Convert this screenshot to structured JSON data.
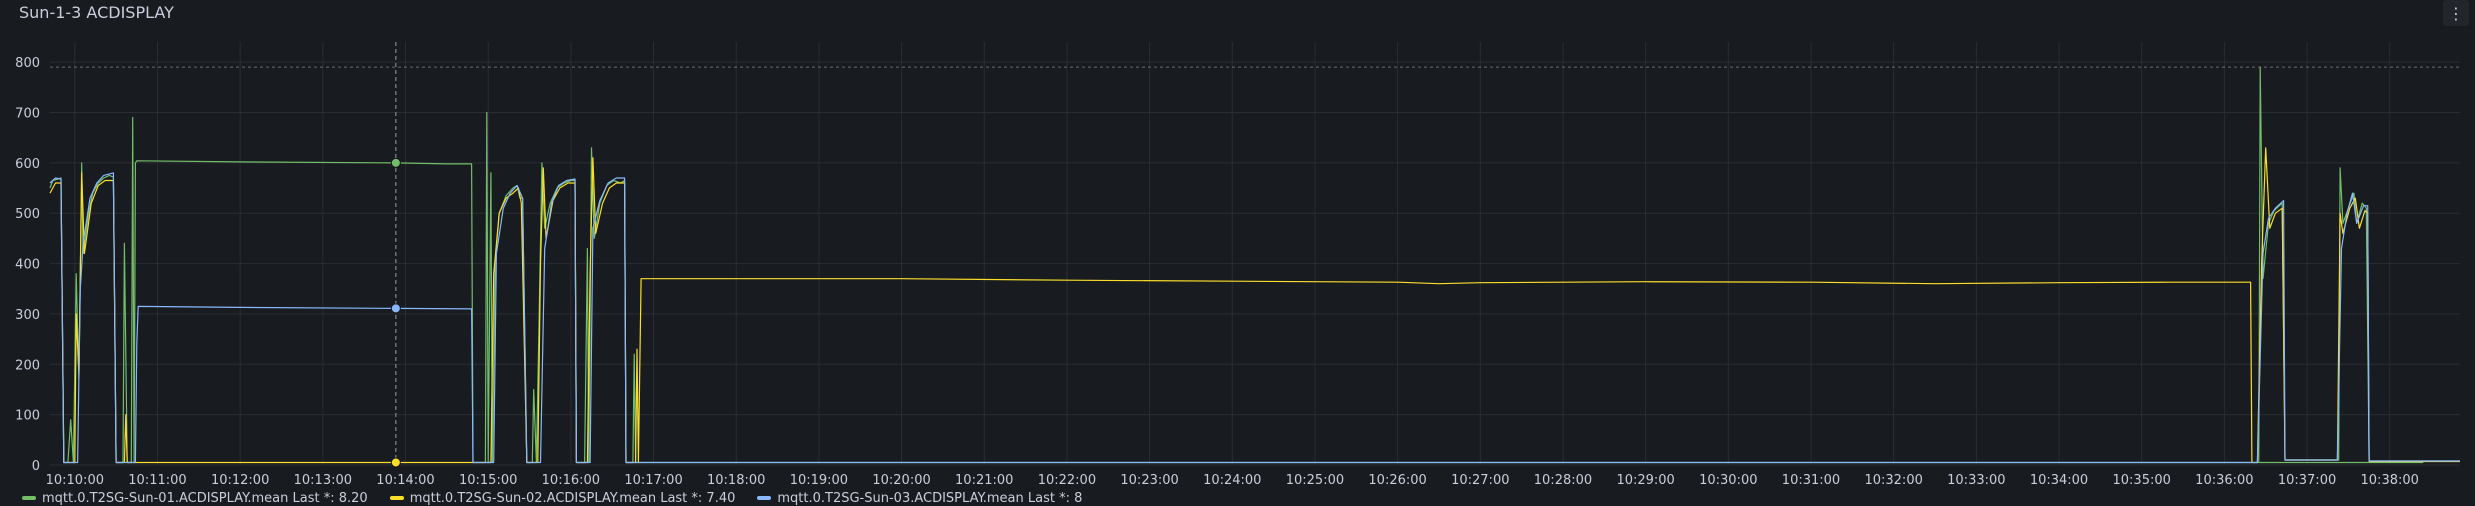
{
  "panel": {
    "title": "Sun-1-3 ACDISPLAY",
    "menu_icon": "vertical-dots-icon"
  },
  "chart_data": {
    "type": "line",
    "title": "Sun-1-3 ACDISPLAY",
    "xlabel": "",
    "ylabel": "",
    "x_unit": "time",
    "x_range": [
      "10:09:42",
      "10:38:51"
    ],
    "ylim": [
      0,
      840
    ],
    "threshold": 790,
    "y_ticks": [
      0,
      100,
      200,
      300,
      400,
      500,
      600,
      700,
      800
    ],
    "x_ticks": [
      "10:10:00",
      "10:11:00",
      "10:12:00",
      "10:13:00",
      "10:14:00",
      "10:15:00",
      "10:16:00",
      "10:17:00",
      "10:18:00",
      "10:19:00",
      "10:20:00",
      "10:21:00",
      "10:22:00",
      "10:23:00",
      "10:24:00",
      "10:25:00",
      "10:26:00",
      "10:27:00",
      "10:28:00",
      "10:29:00",
      "10:30:00",
      "10:31:00",
      "10:32:00",
      "10:33:00",
      "10:34:00",
      "10:35:00",
      "10:36:00",
      "10:37:00",
      "10:38:00"
    ],
    "crosshair_time": "10:13:53",
    "grid": true,
    "legend_position": "bottom",
    "series": [
      {
        "name": "mqtt.0.T2SG-Sun-01.ACDISPLAY.mean",
        "legend": "mqtt.0.T2SG-Sun-01.ACDISPLAY.mean  Last *: 8.20",
        "color": "#73bf69",
        "points": [
          [
            "10:09:42",
            550
          ],
          [
            "10:09:44",
            565
          ],
          [
            "10:09:48",
            568
          ],
          [
            "10:09:50",
            570
          ],
          [
            "10:09:52",
            5
          ],
          [
            "10:09:55",
            5
          ],
          [
            "10:09:57",
            90
          ],
          [
            "10:09:59",
            5
          ],
          [
            "10:10:01",
            380
          ],
          [
            "10:10:03",
            170
          ],
          [
            "10:10:05",
            600
          ],
          [
            "10:10:06",
            420
          ],
          [
            "10:10:10",
            500
          ],
          [
            "10:10:13",
            540
          ],
          [
            "10:10:17",
            560
          ],
          [
            "10:10:21",
            570
          ],
          [
            "10:10:25",
            575
          ],
          [
            "10:10:28",
            572
          ],
          [
            "10:10:30",
            5
          ],
          [
            "10:10:35",
            5
          ],
          [
            "10:10:36",
            440
          ],
          [
            "10:10:38",
            5
          ],
          [
            "10:10:41",
            5
          ],
          [
            "10:10:42",
            690
          ],
          [
            "10:10:43",
            5
          ],
          [
            "10:10:44",
            600
          ],
          [
            "10:10:45",
            604
          ],
          [
            "10:12:00",
            602
          ],
          [
            "10:13:53",
            600
          ],
          [
            "10:14:30",
            598
          ],
          [
            "10:14:48",
            598
          ],
          [
            "10:14:49",
            5
          ],
          [
            "10:14:58",
            5
          ],
          [
            "10:14:59",
            700
          ],
          [
            "10:15:00",
            5
          ],
          [
            "10:15:02",
            580
          ],
          [
            "10:15:03",
            5
          ],
          [
            "10:15:05",
            400
          ],
          [
            "10:15:08",
            500
          ],
          [
            "10:15:13",
            535
          ],
          [
            "10:15:18",
            550
          ],
          [
            "10:15:21",
            555
          ],
          [
            "10:15:23",
            530
          ],
          [
            "10:15:25",
            530
          ],
          [
            "10:15:28",
            5
          ],
          [
            "10:15:32",
            5
          ],
          [
            "10:15:33",
            150
          ],
          [
            "10:15:35",
            5
          ],
          [
            "10:15:37",
            300
          ],
          [
            "10:15:39",
            600
          ],
          [
            "10:15:41",
            470
          ],
          [
            "10:15:45",
            520
          ],
          [
            "10:15:50",
            550
          ],
          [
            "10:15:55",
            560
          ],
          [
            "10:16:00",
            565
          ],
          [
            "10:16:03",
            565
          ],
          [
            "10:16:04",
            5
          ],
          [
            "10:16:10",
            5
          ],
          [
            "10:16:12",
            430
          ],
          [
            "10:16:13",
            5
          ],
          [
            "10:16:15",
            630
          ],
          [
            "10:16:17",
            450
          ],
          [
            "10:16:21",
            520
          ],
          [
            "10:16:26",
            555
          ],
          [
            "10:16:31",
            565
          ],
          [
            "10:16:36",
            560
          ],
          [
            "10:16:39",
            565
          ],
          [
            "10:16:40",
            5
          ],
          [
            "10:16:45",
            5
          ],
          [
            "10:16:46",
            220
          ],
          [
            "10:16:47",
            5
          ],
          [
            "10:16:51",
            5
          ],
          [
            "10:16:52",
            5
          ],
          [
            "10:38:24",
            5
          ],
          [
            "10:36:25",
            5
          ],
          [
            "10:36:26",
            790
          ],
          [
            "10:36:28",
            370
          ],
          [
            "10:36:32",
            480
          ],
          [
            "10:36:36",
            505
          ],
          [
            "10:36:42",
            520
          ],
          [
            "10:36:44",
            10
          ],
          [
            "10:37:20",
            10
          ],
          [
            "10:37:23",
            10
          ],
          [
            "10:37:24",
            590
          ],
          [
            "10:37:26",
            480
          ],
          [
            "10:37:30",
            510
          ],
          [
            "10:37:34",
            540
          ],
          [
            "10:37:36",
            480
          ],
          [
            "10:37:40",
            520
          ],
          [
            "10:37:43",
            510
          ],
          [
            "10:37:45",
            8
          ],
          [
            "10:38:51",
            8
          ]
        ]
      },
      {
        "name": "mqtt.0.T2SG-Sun-02.ACDISPLAY.mean",
        "legend": "mqtt.0.T2SG-Sun-02.ACDISPLAY.mean  Last *: 7.40",
        "color": "#fade2a",
        "points": [
          [
            "10:09:42",
            540
          ],
          [
            "10:09:46",
            560
          ],
          [
            "10:09:50",
            560
          ],
          [
            "10:09:52",
            5
          ],
          [
            "10:10:00",
            5
          ],
          [
            "10:10:01",
            300
          ],
          [
            "10:10:03",
            180
          ],
          [
            "10:10:05",
            580
          ],
          [
            "10:10:07",
            420
          ],
          [
            "10:10:12",
            520
          ],
          [
            "10:10:17",
            555
          ],
          [
            "10:10:22",
            565
          ],
          [
            "10:10:28",
            565
          ],
          [
            "10:10:30",
            5
          ],
          [
            "10:10:36",
            5
          ],
          [
            "10:10:37",
            100
          ],
          [
            "10:10:38",
            5
          ],
          [
            "10:10:42",
            5
          ],
          [
            "10:13:53",
            5
          ],
          [
            "10:14:48",
            5
          ],
          [
            "10:15:02",
            5
          ],
          [
            "10:15:04",
            380
          ],
          [
            "10:15:08",
            500
          ],
          [
            "10:15:13",
            530
          ],
          [
            "10:15:18",
            540
          ],
          [
            "10:15:22",
            550
          ],
          [
            "10:15:24",
            520
          ],
          [
            "10:15:28",
            5
          ],
          [
            "10:15:36",
            5
          ],
          [
            "10:15:38",
            400
          ],
          [
            "10:15:40",
            590
          ],
          [
            "10:15:42",
            450
          ],
          [
            "10:15:47",
            525
          ],
          [
            "10:15:52",
            550
          ],
          [
            "10:15:58",
            560
          ],
          [
            "10:16:03",
            560
          ],
          [
            "10:16:04",
            5
          ],
          [
            "10:16:12",
            5
          ],
          [
            "10:16:14",
            380
          ],
          [
            "10:16:16",
            610
          ],
          [
            "10:16:18",
            460
          ],
          [
            "10:16:23",
            520
          ],
          [
            "10:16:28",
            550
          ],
          [
            "10:16:33",
            560
          ],
          [
            "10:16:39",
            560
          ],
          [
            "10:16:40",
            5
          ],
          [
            "10:16:47",
            5
          ],
          [
            "10:16:48",
            230
          ],
          [
            "10:16:49",
            5
          ],
          [
            "10:16:51",
            370
          ],
          [
            "10:18:00",
            370
          ],
          [
            "10:20:00",
            370
          ],
          [
            "10:22:00",
            367
          ],
          [
            "10:24:00",
            365
          ],
          [
            "10:26:00",
            363
          ],
          [
            "10:26:30",
            360
          ],
          [
            "10:27:00",
            362
          ],
          [
            "10:29:00",
            364
          ],
          [
            "10:31:00",
            363
          ],
          [
            "10:32:30",
            360
          ],
          [
            "10:34:00",
            362
          ],
          [
            "10:35:20",
            363
          ],
          [
            "10:36:19",
            363
          ],
          [
            "10:36:20",
            5
          ],
          [
            "10:36:24",
            5
          ],
          [
            "10:36:27",
            400
          ],
          [
            "10:36:30",
            630
          ],
          [
            "10:36:33",
            470
          ],
          [
            "10:36:37",
            500
          ],
          [
            "10:36:42",
            510
          ],
          [
            "10:36:44",
            10
          ],
          [
            "10:37:20",
            10
          ],
          [
            "10:37:22",
            10
          ],
          [
            "10:37:24",
            500
          ],
          [
            "10:37:26",
            460
          ],
          [
            "10:37:31",
            510
          ],
          [
            "10:37:35",
            530
          ],
          [
            "10:37:38",
            470
          ],
          [
            "10:37:42",
            505
          ],
          [
            "10:37:44",
            500
          ],
          [
            "10:37:45",
            7
          ],
          [
            "10:38:51",
            7
          ]
        ]
      },
      {
        "name": "mqtt.0.T2SG-Sun-03.ACDISPLAY.mean",
        "legend": "mqtt.0.T2SG-Sun-03.ACDISPLAY.mean  Last *: 8",
        "color": "#8ab8ff",
        "points": [
          [
            "10:09:42",
            560
          ],
          [
            "10:09:46",
            570
          ],
          [
            "10:09:50",
            568
          ],
          [
            "10:09:52",
            5
          ],
          [
            "10:10:02",
            5
          ],
          [
            "10:10:04",
            350
          ],
          [
            "10:10:06",
            440
          ],
          [
            "10:10:11",
            530
          ],
          [
            "10:10:16",
            560
          ],
          [
            "10:10:21",
            575
          ],
          [
            "10:10:28",
            580
          ],
          [
            "10:10:30",
            5
          ],
          [
            "10:10:44",
            5
          ],
          [
            "10:10:45",
            240
          ],
          [
            "10:10:46",
            315
          ],
          [
            "10:12:00",
            313
          ],
          [
            "10:13:53",
            311
          ],
          [
            "10:14:48",
            310
          ],
          [
            "10:14:49",
            5
          ],
          [
            "10:15:04",
            5
          ],
          [
            "10:15:06",
            420
          ],
          [
            "10:15:11",
            510
          ],
          [
            "10:15:16",
            540
          ],
          [
            "10:15:21",
            555
          ],
          [
            "10:15:25",
            530
          ],
          [
            "10:15:28",
            5
          ],
          [
            "10:15:38",
            5
          ],
          [
            "10:15:41",
            430
          ],
          [
            "10:15:46",
            520
          ],
          [
            "10:15:51",
            555
          ],
          [
            "10:15:57",
            565
          ],
          [
            "10:16:03",
            568
          ],
          [
            "10:16:04",
            5
          ],
          [
            "10:16:14",
            5
          ],
          [
            "10:16:16",
            470
          ],
          [
            "10:16:21",
            525
          ],
          [
            "10:16:27",
            560
          ],
          [
            "10:16:33",
            570
          ],
          [
            "10:16:39",
            570
          ],
          [
            "10:16:40",
            5
          ],
          [
            "10:18:00",
            5
          ],
          [
            "10:26:00",
            5
          ],
          [
            "10:34:00",
            5
          ],
          [
            "10:36:24",
            5
          ],
          [
            "10:36:28",
            420
          ],
          [
            "10:36:32",
            490
          ],
          [
            "10:36:37",
            510
          ],
          [
            "10:36:43",
            525
          ],
          [
            "10:36:44",
            10
          ],
          [
            "10:37:22",
            10
          ],
          [
            "10:37:25",
            430
          ],
          [
            "10:37:29",
            500
          ],
          [
            "10:37:33",
            540
          ],
          [
            "10:37:36",
            480
          ],
          [
            "10:37:41",
            515
          ],
          [
            "10:37:44",
            515
          ],
          [
            "10:37:45",
            8
          ],
          [
            "10:38:51",
            8
          ]
        ]
      }
    ]
  }
}
